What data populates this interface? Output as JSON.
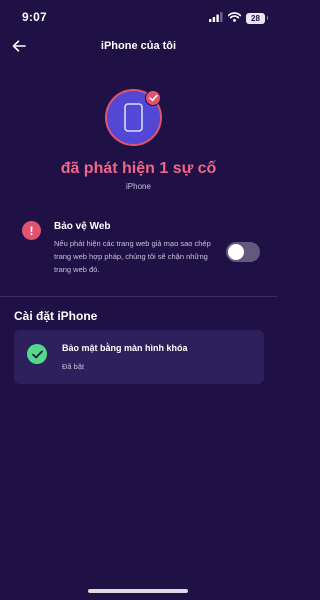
{
  "status_bar": {
    "time": "9:07",
    "battery": "28",
    "icons": [
      "cellular-signal-icon",
      "wifi-icon",
      "battery-icon"
    ]
  },
  "nav": {
    "title": "iPhone của tôi",
    "back_icon": "arrow-left-icon"
  },
  "device": {
    "icon": "smartphone-icon",
    "badge_icon": "checkmark-icon"
  },
  "summary": {
    "issue_title": "đã phát hiện 1 sự cố",
    "device_name": "iPhone"
  },
  "web_protection": {
    "icon": "alert-exclamation-icon",
    "mark": "!",
    "title": "Bảo vệ Web",
    "description": "Nếu phát hiện các trang web giả mạo sao chép trang web hợp pháp, chúng tôi sẽ chặn những trang web đó.",
    "enabled": false
  },
  "settings_section": {
    "title": "Cài đặt iPhone",
    "items": [
      {
        "icon": "checkmark-circle-icon",
        "title": "Bảo mật bằng màn hình khóa",
        "status": "Đã bật"
      }
    ]
  },
  "colors": {
    "background": "#1f1145",
    "accent_pink": "#f06686",
    "alert_red": "#e2536f",
    "device_blue": "#5347d6",
    "success_green": "#54d98c",
    "card_bg": "#2d205c"
  }
}
